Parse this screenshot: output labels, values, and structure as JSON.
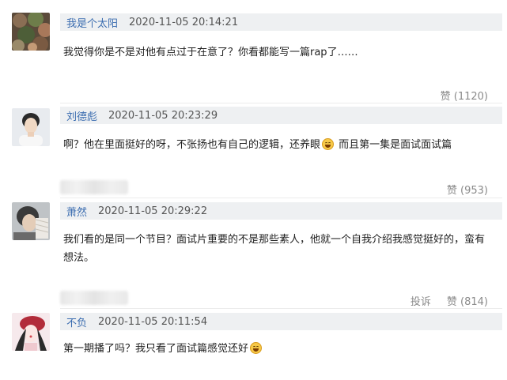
{
  "comments": [
    {
      "user": "我是个太阳",
      "time": "2020-11-05 20:14:21",
      "text": "我觉得你是不是对他有点过于在意了？你看都能写一篇rap了……",
      "like_label": "赞",
      "like_count": "(1120)"
    },
    {
      "user": "刘德彪",
      "time": "2020-11-05 20:23:29",
      "text_before": "啊？他在里面挺好的呀，不张扬也有自己的逻辑，还养眼",
      "text_after": " 而且第一集是面试面试篇",
      "like_label": "赞",
      "like_count": "(953)"
    },
    {
      "user": "萧然",
      "time": "2020-11-05 20:29:22",
      "text": "我们看的是同一个节目？面试片重要的不是那些素人，他就一个自我介绍我感觉挺好的，蛮有想法。",
      "report_label": "投诉",
      "like_label": "赞",
      "like_count": "(814)"
    },
    {
      "user": "不负",
      "time": "2020-11-05 20:11:54",
      "text": "第一期播了吗？我只看了面试篇感觉还好"
    }
  ],
  "icons": {
    "laugh_emoji": "laughing-tears-emoji"
  }
}
